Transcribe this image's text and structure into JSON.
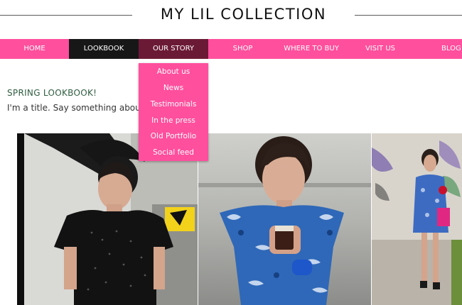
{
  "header": {
    "title": "MY LIL COLLECTION"
  },
  "nav": {
    "items": [
      "HOME",
      "LOOKBOOK",
      "OUR STORY",
      "SHOP",
      "WHERE TO BUY",
      "VISIT US",
      "BLOG"
    ],
    "active": "LOOKBOOK",
    "hovered": "OUR STORY"
  },
  "dropdown": {
    "items": [
      "About us",
      "News",
      "Testimonials",
      "In the press",
      "Old Portfolio",
      "Social feed"
    ]
  },
  "content": {
    "heading": "SPRING LOOKBOOK!",
    "subtitle": "I'm a title. Say something about"
  },
  "gallery": {
    "prev_icon": "chevron-left-icon",
    "photos": [
      "photo-black-sequin-dress",
      "photo-blue-ruffle-dress",
      "photo-blue-floral-dress"
    ]
  },
  "colors": {
    "nav_bg": "#ff4f9d",
    "nav_active": "#171717",
    "nav_hover": "#6b1a36",
    "heading": "#2f5e40"
  }
}
